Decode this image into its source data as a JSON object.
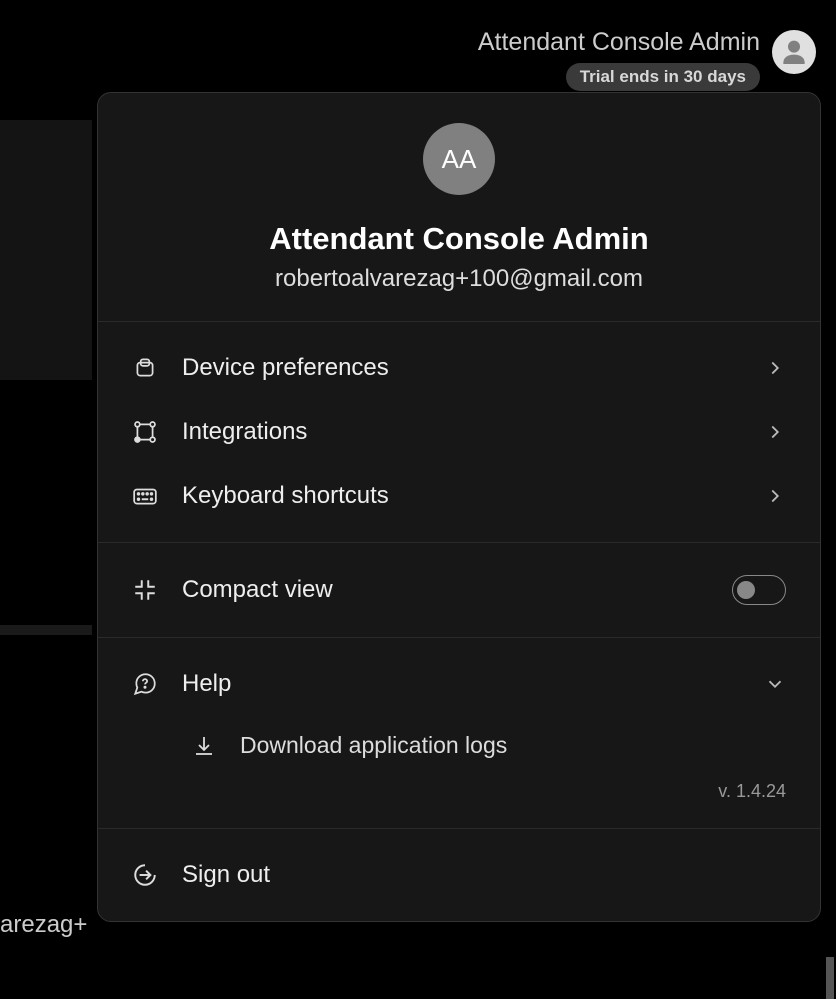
{
  "header": {
    "title": "Attendant Console Admin",
    "trial_badge": "Trial ends in 30 days"
  },
  "background": {
    "partial_text": "arezag+"
  },
  "profile": {
    "initials": "AA",
    "name": "Attendant Console Admin",
    "email": "robertoalvarezag+100@gmail.com"
  },
  "menu": {
    "device_preferences": "Device preferences",
    "integrations": "Integrations",
    "keyboard_shortcuts": "Keyboard shortcuts",
    "compact_view": "Compact view",
    "compact_view_enabled": false,
    "help": "Help",
    "download_logs": "Download application logs",
    "sign_out": "Sign out"
  },
  "version": "v. 1.4.24"
}
